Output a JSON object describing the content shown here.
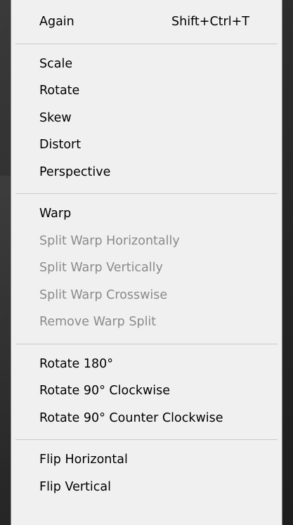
{
  "menu": {
    "again": {
      "label": "Again",
      "shortcut": "Shift+Ctrl+T"
    },
    "group_transform": [
      {
        "label": "Scale"
      },
      {
        "label": "Rotate"
      },
      {
        "label": "Skew"
      },
      {
        "label": "Distort"
      },
      {
        "label": "Perspective"
      }
    ],
    "group_warp": [
      {
        "label": "Warp",
        "enabled": true
      },
      {
        "label": "Split Warp Horizontally",
        "enabled": false
      },
      {
        "label": "Split Warp Vertically",
        "enabled": false
      },
      {
        "label": "Split Warp Crosswise",
        "enabled": false
      },
      {
        "label": "Remove Warp Split",
        "enabled": false
      }
    ],
    "group_rotate": [
      {
        "label": "Rotate 180°"
      },
      {
        "label": "Rotate 90° Clockwise"
      },
      {
        "label": "Rotate 90° Counter Clockwise"
      }
    ],
    "group_flip": [
      {
        "label": "Flip Horizontal"
      },
      {
        "label": "Flip Vertical"
      }
    ]
  },
  "colors": {
    "menu_background": "#f0f0f0",
    "enabled_text": "#000000",
    "disabled_text": "#8a8a8a",
    "backdrop": "#2a2a2a"
  }
}
